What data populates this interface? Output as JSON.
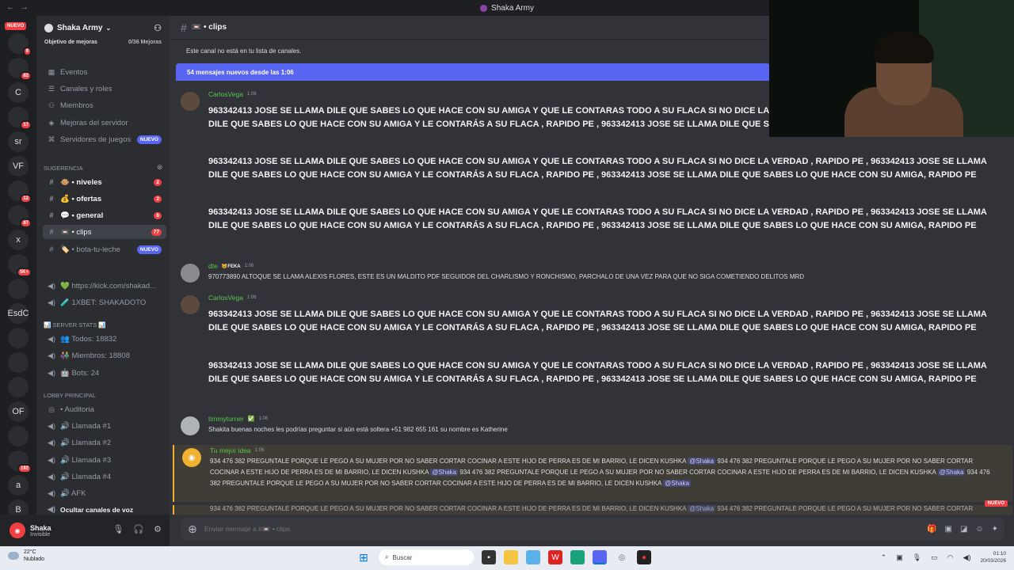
{
  "window": {
    "title": "Shaka Army"
  },
  "rail": {
    "nuevo": "NUEVO",
    "servers": [
      {
        "label": "",
        "badge": "9"
      },
      {
        "label": "",
        "badge": "82"
      },
      {
        "label": "C",
        "badge": ""
      },
      {
        "label": "",
        "badge": "17"
      },
      {
        "label": "sr",
        "badge": ""
      },
      {
        "label": "VF",
        "badge": ""
      },
      {
        "label": "",
        "badge": "12"
      },
      {
        "label": "",
        "badge": "87"
      },
      {
        "label": "x",
        "badge": ""
      },
      {
        "label": "",
        "badge": "5K+"
      },
      {
        "label": "",
        "badge": ""
      },
      {
        "label": "EsdC",
        "badge": ""
      },
      {
        "label": "",
        "badge": ""
      },
      {
        "label": "",
        "badge": ""
      },
      {
        "label": "",
        "badge": ""
      },
      {
        "label": "OF",
        "badge": ""
      },
      {
        "label": "",
        "badge": ""
      },
      {
        "label": "",
        "badge": "192"
      },
      {
        "label": "a",
        "badge": ""
      },
      {
        "label": "B",
        "badge": ""
      }
    ]
  },
  "sidebar": {
    "server_name": "Shaka Army",
    "boost_goal": "Objetivo de mejoras",
    "boost_count": "0/36 Mejoras",
    "items": [
      {
        "label": "Eventos"
      },
      {
        "label": "Canales y roles"
      },
      {
        "label": "Miembros"
      },
      {
        "label": "Mejoras del servidor"
      },
      {
        "label": "Servidores de juegos",
        "badge": "NUEVO"
      }
    ],
    "cat_sugerencia": "Sugerencia",
    "channels": [
      {
        "label": "🐵 • niveles",
        "count": "2"
      },
      {
        "label": "💰 • ofertas",
        "count": "2"
      },
      {
        "label": "💬 • general",
        "count": "6"
      },
      {
        "label": "📼 • clips",
        "count": "77"
      },
      {
        "label": "🏷️ • bota-tu-leche",
        "badge": "NUEVO"
      }
    ],
    "links": [
      {
        "label": "💚 https://kick.com/shakad..."
      },
      {
        "label": "🧪 1XBET: SHAKADOTO"
      }
    ],
    "cat_stats": "📊 SERVER STATS 📊",
    "stats": [
      {
        "label": "👥 Todos: 18832"
      },
      {
        "label": "👫 Miembros: 18808"
      },
      {
        "label": "🤖 Bots: 24"
      }
    ],
    "cat_lobby": "LOBBY PRINCIPAL",
    "voice": [
      {
        "label": "• Auditoria"
      },
      {
        "label": "🔊 Llamada #1"
      },
      {
        "label": "🔊 Llamada #2"
      },
      {
        "label": "🔊 Llamada #3"
      },
      {
        "label": "🔊 Llamada #4"
      },
      {
        "label": "🔊 AFK"
      },
      {
        "label": "Ocultar canales de voz"
      }
    ]
  },
  "user": {
    "name": "Shaka",
    "status": "Invisible"
  },
  "channel": {
    "name": "📼 • clips",
    "notice": "Este canal no está en tu lista de canales.",
    "new_messages": "54 mensajes nuevos desde las 1:06"
  },
  "messages": {
    "m1": {
      "author": "CarlosVega",
      "time": "1:06",
      "author_color": "#57c54c",
      "p1": "963342413 JOSE SE LLAMA DILE QUE SABES LO QUE HACE CON SU AMIGA Y QUE LE CONTARAS TODO A SU FLACA SI NO DICE LA VERDAD , RAPIDO PE , 963342413 JOSE SE LLAMA DILE QUE SABES LO QUE HACE CON SU AMIGA Y LE CONTARÁS A SU FLACA , RAPIDO PE , 963342413 JOSE SE LLAMA DILE QUE SABES LO QUE HACE CON SU AMIGA, RAPIDO PE",
      "p2": "963342413 JOSE SE LLAMA DILE QUE SABES LO QUE HACE CON SU AMIGA Y QUE LE CONTARAS TODO A SU FLACA SI NO DICE LA VERDAD , RAPIDO PE , 963342413 JOSE SE LLAMA DILE QUE SABES LO QUE HACE CON SU AMIGA Y LE CONTARÁS A SU FLACA , RAPIDO PE , 963342413 JOSE SE LLAMA DILE QUE SABES LO QUE HACE CON SU AMIGA, RAPIDO PE",
      "p3": "963342413 JOSE SE LLAMA DILE QUE SABES LO QUE HACE CON SU AMIGA Y QUE LE CONTARAS TODO A SU FLACA SI NO DICE LA VERDAD , RAPIDO PE , 963342413 JOSE SE LLAMA DILE QUE SABES LO QUE HACE CON SU AMIGA Y LE CONTARÁS A SU FLACA , RAPIDO PE , 963342413 JOSE SE LLAMA DILE QUE SABES LO QUE HACE CON SU AMIGA, RAPIDO PE"
    },
    "m2": {
      "author": "dte",
      "tag": "😺FEKA",
      "time": "1:06",
      "author_color": "#57c54c",
      "p1": "970773890 ALTOQUE SE LLAMA ALEXIS FLORES, ESTE ES UN MALDITO PDF SEGUIDOR DEL CHARLISMO Y RONCHISMO, PARCHALO DE UNA VEZ PARA QUE NO SIGA COMETIENDO DELITOS MRD"
    },
    "m3": {
      "author": "CarlosVega",
      "time": "1:06",
      "author_color": "#57c54c",
      "p1": "963342413 JOSE SE LLAMA DILE QUE SABES LO QUE HACE CON SU AMIGA Y QUE LE CONTARAS TODO A SU FLACA SI NO DICE LA VERDAD , RAPIDO PE , 963342413 JOSE SE LLAMA DILE QUE SABES LO QUE HACE CON SU AMIGA Y LE CONTARÁS A SU FLACA , RAPIDO PE , 963342413 JOSE SE LLAMA DILE QUE SABES LO QUE HACE CON SU AMIGA, RAPIDO PE",
      "p2": "963342413 JOSE SE LLAMA DILE QUE SABES LO QUE HACE CON SU AMIGA Y QUE LE CONTARAS TODO A SU FLACA SI NO DICE LA VERDAD , RAPIDO PE , 963342413 JOSE SE LLAMA DILE QUE SABES LO QUE HACE CON SU AMIGA Y LE CONTARÁS A SU FLACA , RAPIDO PE , 963342413 JOSE SE LLAMA DILE QUE SABES LO QUE HACE CON SU AMIGA, RAPIDO PE"
    },
    "m4": {
      "author": "timmyturner",
      "badge": "✅",
      "time": "1:06",
      "author_color": "#57c54c",
      "p1": "Shakita buenas noches les podrías preguntar si aún está soltera +51 982 655 161 su nombre es Katherine"
    },
    "m5": {
      "author": "Tu mejor idea",
      "time": "1:06",
      "author_color": "#57c54c",
      "seg": "934 476 382 PREGUNTALE PORQUE LE PEGO A SU MUJER POR NO SABER CORTAR COCINAR A ESTE HIJO DE PERRA ES DE MI BARRIO, LE DICEN KUSHKA",
      "mention": "@Shaka"
    },
    "nuevo": "NUEVO"
  },
  "composer": {
    "placeholder": "Enviar mensaje a #📼 • clips"
  },
  "taskbar": {
    "temp": "22°C",
    "weather": "Nublado",
    "search": "Buscar",
    "time": "01:10",
    "date": "20/03/2026"
  }
}
